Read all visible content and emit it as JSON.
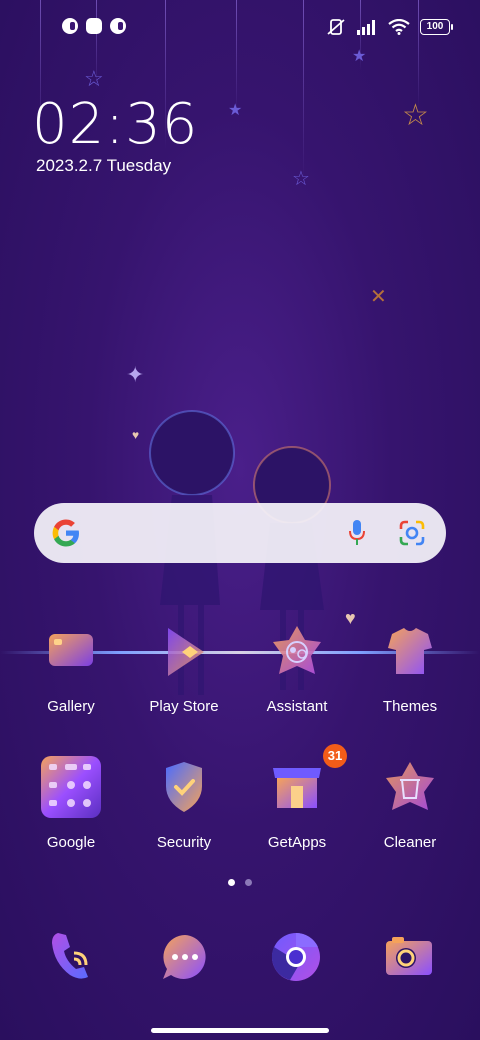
{
  "status_bar": {
    "left_icons": [
      "notification-icon",
      "app-icon",
      "notification-icon"
    ],
    "right_icons": [
      "mute-icon",
      "signal-icon",
      "wifi-icon"
    ],
    "battery": "100"
  },
  "clock": {
    "time": "02:36",
    "date": "2023.2.7 Tuesday"
  },
  "search_bar": {
    "icons": [
      "google-icon",
      "mic-icon",
      "lens-icon"
    ]
  },
  "apps": [
    {
      "label": "Gallery",
      "icon": "gallery-icon"
    },
    {
      "label": "Play Store",
      "icon": "play-store-icon"
    },
    {
      "label": "Assistant",
      "icon": "assistant-icon"
    },
    {
      "label": "Themes",
      "icon": "themes-icon"
    },
    {
      "label": "Google",
      "icon": "google-folder-icon"
    },
    {
      "label": "Security",
      "icon": "security-icon"
    },
    {
      "label": "GetApps",
      "icon": "getapps-icon",
      "badge": "31"
    },
    {
      "label": "Cleaner",
      "icon": "cleaner-icon"
    }
  ],
  "page_indicator": {
    "pages": 2,
    "current": 1
  },
  "dock": [
    {
      "icon": "phone-icon"
    },
    {
      "icon": "messages-icon"
    },
    {
      "icon": "chrome-icon"
    },
    {
      "icon": "camera-icon"
    }
  ],
  "colors": {
    "background": "#36146e",
    "accent_orange": "#f5a623",
    "accent_purple": "#8a4fff",
    "badge": "#f25c19"
  }
}
